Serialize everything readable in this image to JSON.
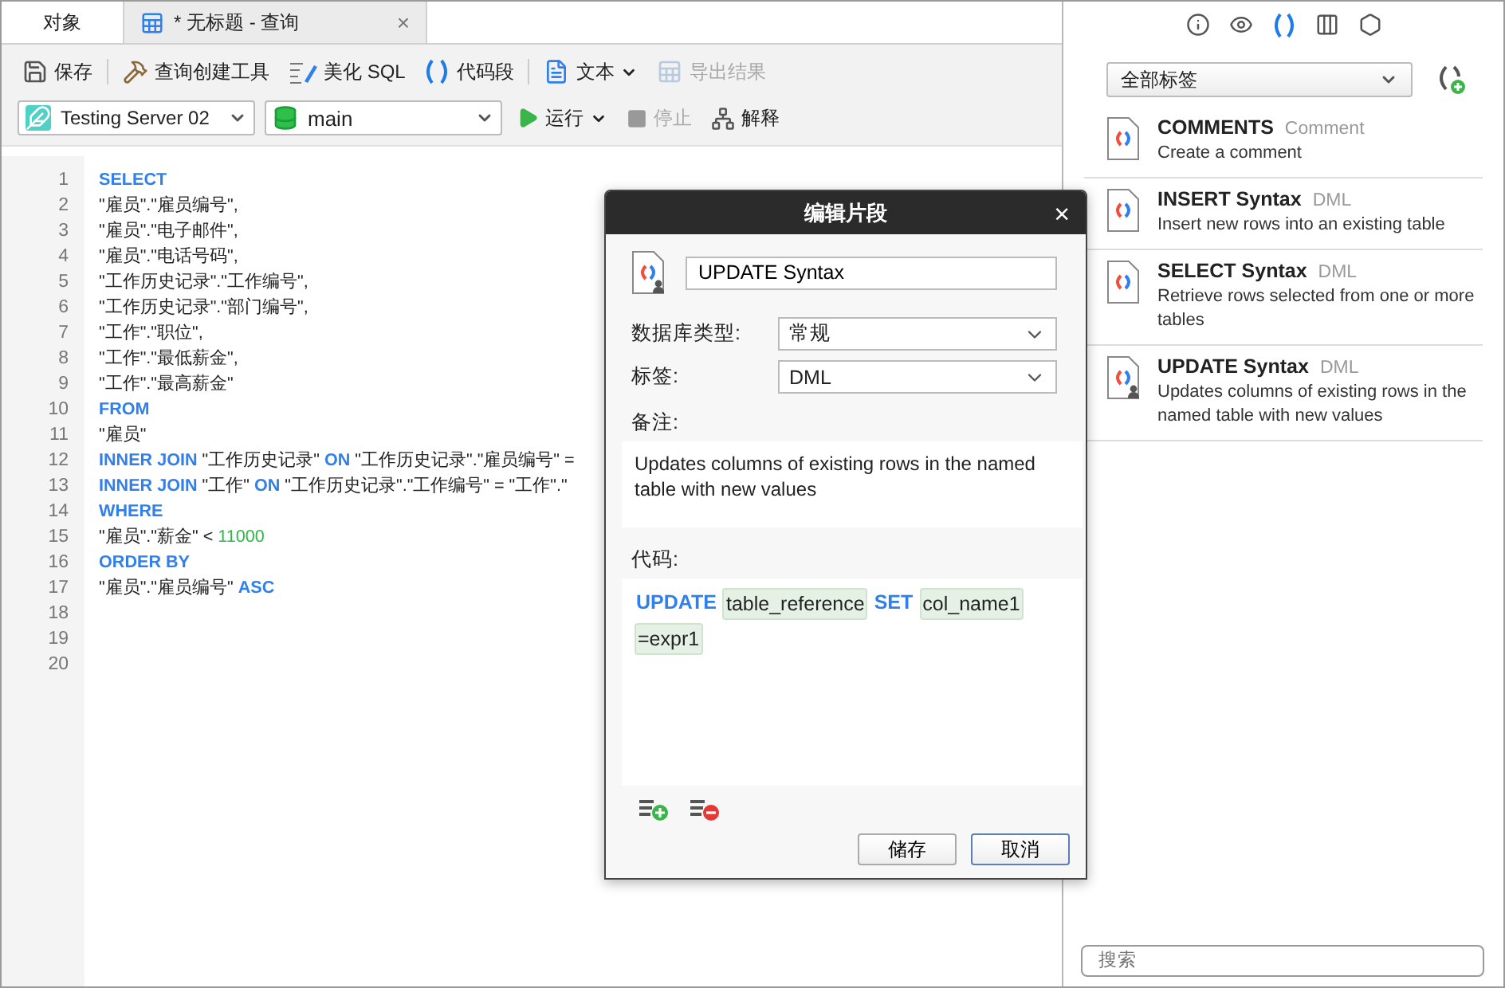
{
  "tabs": [
    {
      "label": "对象",
      "kind": "plain",
      "selected": false
    },
    {
      "label": "* 无标题 - 查询",
      "kind": "query",
      "selected": true,
      "close": "×"
    }
  ],
  "toolbar": [
    {
      "kind": "save",
      "label": "保存",
      "disabled": false
    },
    {
      "kind": "builder",
      "label": "查询创建工具",
      "disabled": false
    },
    {
      "kind": "beautify",
      "label": "美化 SQL",
      "disabled": false
    },
    {
      "kind": "snippet",
      "label": "代码段",
      "disabled": false
    },
    {
      "kind": "text",
      "label": "文本",
      "disabled": false,
      "menu": true
    },
    {
      "kind": "export",
      "label": "导出结果",
      "disabled": true
    }
  ],
  "connection": {
    "server": "Testing Server 02",
    "database": "main"
  },
  "run_controls": [
    {
      "kind": "run",
      "label": "运行",
      "disabled": false,
      "menu": true
    },
    {
      "kind": "stop",
      "label": "停止",
      "disabled": true
    },
    {
      "kind": "explain",
      "label": "解释",
      "disabled": false
    }
  ],
  "editor": {
    "lines": [
      {
        "number": "1",
        "tokens": [
          {
            "kind": "keyword",
            "text": "SELECT"
          }
        ]
      },
      {
        "number": "2",
        "tokens": [
          {
            "kind": "text",
            "text": "\"雇员\".\"雇员编号\","
          }
        ]
      },
      {
        "number": "3",
        "tokens": [
          {
            "kind": "text",
            "text": "\"雇员\".\"电子邮件\","
          }
        ]
      },
      {
        "number": "4",
        "tokens": [
          {
            "kind": "text",
            "text": "\"雇员\".\"电话号码\","
          }
        ]
      },
      {
        "number": "5",
        "tokens": [
          {
            "kind": "text",
            "text": "\"工作历史记录\".\"工作编号\","
          }
        ]
      },
      {
        "number": "6",
        "tokens": [
          {
            "kind": "text",
            "text": "\"工作历史记录\".\"部门编号\","
          }
        ]
      },
      {
        "number": "7",
        "tokens": [
          {
            "kind": "text",
            "text": "\"工作\".\"职位\","
          }
        ]
      },
      {
        "number": "8",
        "tokens": [
          {
            "kind": "text",
            "text": "\"工作\".\"最低薪金\","
          }
        ]
      },
      {
        "number": "9",
        "tokens": [
          {
            "kind": "text",
            "text": "\"工作\".\"最高薪金\""
          }
        ]
      },
      {
        "number": "10",
        "tokens": [
          {
            "kind": "keyword",
            "text": "FROM"
          }
        ]
      },
      {
        "number": "11",
        "tokens": [
          {
            "kind": "text",
            "text": "\"雇员\""
          }
        ]
      },
      {
        "number": "12",
        "tokens": [
          {
            "kind": "keyword",
            "text": "INNER JOIN"
          },
          {
            "kind": "text",
            "text": "\"工作历史记录\""
          },
          {
            "kind": "keyword",
            "text": "ON"
          },
          {
            "kind": "text",
            "text": "\"工作历史记录\".\"雇员编号\" ="
          }
        ]
      },
      {
        "number": "13",
        "tokens": [
          {
            "kind": "keyword",
            "text": "INNER JOIN"
          },
          {
            "kind": "text",
            "text": "\"工作\""
          },
          {
            "kind": "keyword",
            "text": "ON"
          },
          {
            "kind": "text",
            "text": "\"工作历史记录\".\"工作编号\" = \"工作\".\""
          }
        ]
      },
      {
        "number": "14",
        "tokens": [
          {
            "kind": "keyword",
            "text": "WHERE"
          }
        ]
      },
      {
        "number": "15",
        "tokens": [
          {
            "kind": "text",
            "text": "\"雇员\".\"薪金\" <"
          },
          {
            "kind": "number",
            "text": "11000"
          }
        ]
      },
      {
        "number": "16",
        "tokens": [
          {
            "kind": "keyword",
            "text": "ORDER BY"
          }
        ]
      },
      {
        "number": "17",
        "tokens": [
          {
            "kind": "text",
            "text": "\"雇员\".\"雇员编号\""
          },
          {
            "kind": "keyword",
            "text": "ASC"
          }
        ]
      },
      {
        "number": "18"
      },
      {
        "number": "19"
      },
      {
        "number": "20"
      }
    ]
  },
  "dialog": {
    "title": "编辑片段",
    "close": "×",
    "name": "UPDATE Syntax",
    "fields": [
      {
        "label": "数据库类型:",
        "value": "常规"
      },
      {
        "label": "标签:",
        "value": "DML"
      }
    ],
    "note_label": "备注:",
    "note": "Updates columns of existing rows in the named table with new values",
    "code_label": "代码:",
    "code": [
      {
        "kind": "keyword",
        "text": "UPDATE"
      },
      {
        "kind": "placeholder",
        "text": "table_reference"
      },
      {
        "kind": "keyword",
        "text": "SET"
      },
      {
        "kind": "placeholder",
        "text": "col_name1"
      },
      {
        "kind": "placeholder",
        "text": "=expr1"
      }
    ],
    "buttons": [
      {
        "label": "储存",
        "default": false
      },
      {
        "label": "取消",
        "default": true
      }
    ]
  },
  "side_panel": {
    "tabs": [
      {
        "kind": "info",
        "selected": false
      },
      {
        "kind": "preview",
        "selected": false
      },
      {
        "kind": "snippets",
        "selected": true
      },
      {
        "kind": "columns",
        "selected": false
      },
      {
        "kind": "settings",
        "selected": false
      }
    ],
    "filter": "全部标签",
    "snippets": [
      {
        "name": "COMMENTS",
        "tag": "Comment",
        "description": "Create a comment",
        "user": false
      },
      {
        "name": "INSERT Syntax",
        "tag": "DML",
        "description": "Insert new rows into an existing table",
        "user": false
      },
      {
        "name": "SELECT Syntax",
        "tag": "DML",
        "description": "Retrieve rows selected from one or more tables",
        "user": false
      },
      {
        "name": "UPDATE Syntax",
        "tag": "DML",
        "description": "Updates columns of existing rows in the named table with new values",
        "user": true
      }
    ],
    "search": {
      "placeholder": "搜索"
    }
  }
}
